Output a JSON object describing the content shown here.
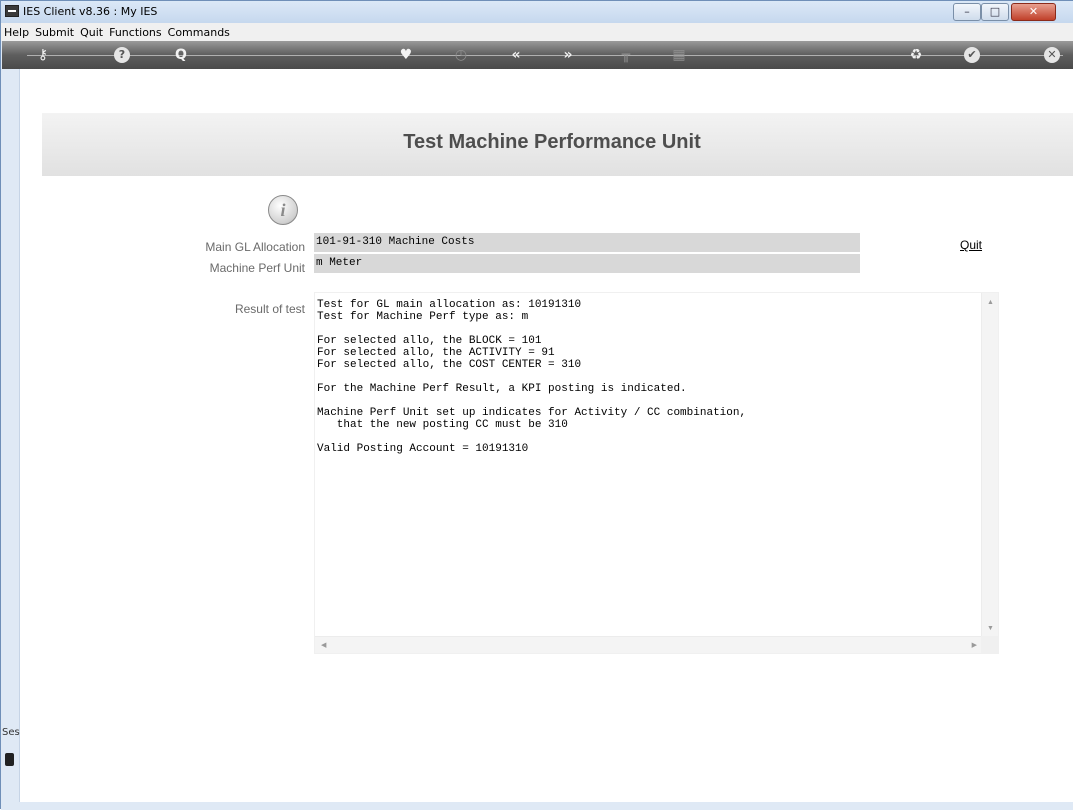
{
  "window": {
    "title": "IES Client v8.36 : My IES",
    "controls": [
      "–",
      "□",
      "✕"
    ]
  },
  "menu": [
    "Help",
    "Submit",
    "Quit",
    "Functions",
    "Commands"
  ],
  "toolbar": {
    "icons": [
      "key-icon",
      "help-icon",
      "search-icon",
      "heart-icon",
      "clock-icon",
      "previous-icon",
      "next-icon",
      "tools-icon",
      "grid-icon",
      "recycle-icon",
      "check-icon",
      "close-icon"
    ]
  },
  "page": {
    "title": "Test Machine Performance Unit"
  },
  "form": {
    "main_gl_label": "Main GL Allocation",
    "main_gl_value": "101-91-310 Machine Costs",
    "machine_perf_label": "Machine Perf Unit",
    "machine_perf_value": "m Meter",
    "result_label": "Result of test",
    "quit_label": "Quit"
  },
  "result": {
    "lines": "Test for GL main allocation as: 10191310\nTest for Machine Perf type as: m\n\nFor selected allo, the BLOCK = 101\nFor selected allo, the ACTIVITY = 91\nFor selected allo, the COST CENTER = 310\n\nFor the Machine Perf Result, a KPI posting is indicated.\n\nMachine Perf Unit set up indicates for Activity / CC combination,\n   that the new posting CC must be 310\n\nValid Posting Account = 10191310"
  },
  "session": {
    "label": "Ses"
  }
}
